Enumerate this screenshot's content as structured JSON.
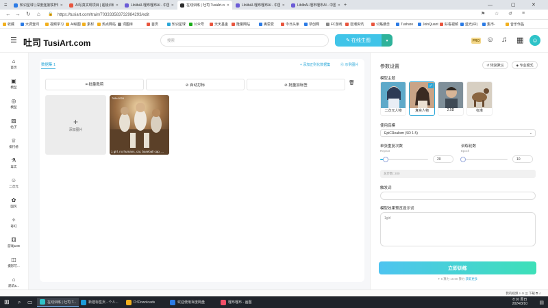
{
  "browser": {
    "tabs": [
      {
        "label": "知识星球 | 深度连接铁杆粉丝",
        "color": "#2c7be5",
        "active": false
      },
      {
        "label": "AI写真实现项目 | 超级训练营",
        "color": "#e8553e",
        "active": false
      },
      {
        "label": "LiblibAI-哩布哩布AI - 中国领",
        "color": "#6b5bd6",
        "active": false
      },
      {
        "label": "在线训练 | 吐司 TusiArt.com",
        "color": "#2b2b2b",
        "active": true
      },
      {
        "label": "LiblibAI-哩布哩布AI - 中国领",
        "color": "#6b5bd6",
        "active": false
      },
      {
        "label": "LiblibAI-哩布哩布AI - 中国领",
        "color": "#6b5bd6",
        "active": false
      }
    ],
    "new_tab": "+",
    "url": "https://tusiart.com/train/703333583732984293/edit",
    "bookmarks": [
      {
        "label": "收藏",
        "color": "#f2b01e"
      },
      {
        "label": "大调查问",
        "color": "#2c7be5"
      },
      {
        "label": "视频学习",
        "color": "#f2b01e"
      },
      {
        "label": "AI绘图",
        "color": "#f2b01e"
      },
      {
        "label": "素材",
        "color": "#f2b01e"
      },
      {
        "label": "热点网站",
        "color": "#f2b01e"
      },
      {
        "label": "词图库",
        "color": "#888888"
      },
      {
        "label": "首页",
        "color": "#e8553e"
      },
      {
        "label": "知识星球",
        "color": "#2aa7d8"
      },
      {
        "label": "公众号",
        "color": "#1aad19"
      },
      {
        "label": "天天基金",
        "color": "#e8553e"
      },
      {
        "label": "隆量网站",
        "color": "#e8553e"
      },
      {
        "label": "奥思爱",
        "color": "#2c7be5"
      },
      {
        "label": "今日头条",
        "color": "#e8553e"
      },
      {
        "label": "草创网",
        "color": "#2c7be5"
      },
      {
        "label": "FC游戏",
        "color": "#888888"
      },
      {
        "label": "巨潮资讯",
        "color": "#e8553e"
      },
      {
        "label": "公路悬念",
        "color": "#e8553e"
      },
      {
        "label": "Tushare",
        "color": "#2c7be5"
      },
      {
        "label": "JoinQuant",
        "color": "#2c7be5"
      },
      {
        "label": "好看视频",
        "color": "#e8553e"
      },
      {
        "label": "蓝光(中)",
        "color": "#2c7be5"
      },
      {
        "label": "集市-",
        "color": "#2c7be5"
      },
      {
        "label": "音乐作品",
        "color": "#f2b01e"
      }
    ]
  },
  "header": {
    "logo_mark": "吐司",
    "logo_text": "TusiArt.com",
    "search_placeholder": "搜索",
    "generate_label": "✎ 在线生图",
    "pro_badge": "PRO"
  },
  "sidebar": {
    "items": [
      {
        "label": "首页",
        "icon": "⌂",
        "icon_name": "home-icon"
      },
      {
        "label": "模型",
        "icon": "▣",
        "icon_name": "model-icon"
      },
      {
        "label": "模型",
        "icon": "◎",
        "icon_name": "compass-icon"
      },
      {
        "label": "帖子",
        "icon": "▨",
        "icon_name": "image-icon"
      },
      {
        "label": "排行榜",
        "icon": "♕",
        "icon_name": "trophy-icon"
      },
      {
        "label": "毒实",
        "icon": "⚗",
        "icon_name": "flask-icon"
      },
      {
        "label": "二次元",
        "icon": "☺",
        "icon_name": "anime-icon"
      },
      {
        "label": "国风",
        "icon": "✿",
        "icon_name": "flower-icon"
      },
      {
        "label": "奇幻",
        "icon": "✧",
        "icon_name": "fantasy-icon"
      },
      {
        "label": "游戏&3D",
        "icon": "⚅",
        "icon_name": "game-icon"
      },
      {
        "label": "摄影写...",
        "icon": "◫",
        "icon_name": "camera-icon"
      },
      {
        "label": "建筑&...",
        "icon": "⌂",
        "icon_name": "building-icon"
      }
    ]
  },
  "main": {
    "dataset_tab": "数据集 1",
    "add_dataset_link": "+ 添加正则化数据集",
    "example_link": "⓪ 示例图片",
    "toolbar": {
      "crop_label": "⌗ 批量裁剪",
      "tag_label": "⊘ 自动打标",
      "add_tag_label": "⊘ 批量加标签"
    },
    "add_image_plus": "+",
    "add_image_label": "添加图片",
    "thumb_tag": "768×1024",
    "thumb_caption": "1 girl, no humans, cat, baseball cap, ..."
  },
  "settings": {
    "title": "参数设置",
    "restore_label": "↺ 恢复默认",
    "pro_mode_label": "◈ 专业模式",
    "base_model_label": "模型主题",
    "models": [
      {
        "name": "二次元人物"
      },
      {
        "name": "真实人物",
        "selected": true
      },
      {
        "name": "2.5D"
      },
      {
        "name": "标准"
      }
    ],
    "base_label": "使用底模",
    "base_value": "EpiCRealism (SD 1.5)",
    "repeat_label": "单张重复次数",
    "repeat_sub": "Repeat",
    "repeat_value": "20",
    "repeat_fraction": 0.12,
    "epoch_label": "训练轮数",
    "epoch_sub": "Epoch",
    "epoch_value": "10",
    "epoch_fraction": 0.05,
    "seed_text": "总步数: 200",
    "trigger_label": "触发词",
    "prompt_label": "模型效果预览提示词",
    "prompt_value": "1girl",
    "train_label": "立即训练",
    "credit_text": "✦ 6 算力 10.00 算力",
    "credit_link": "获取更多"
  },
  "status": {
    "left": "",
    "right": "我的视频    ⌕    ⊙    ◫  下载    ⧉    ♫"
  },
  "taskbar": {
    "items": [
      {
        "label": "在线训练 | 吐司 T...",
        "color": "#2ec3c8",
        "active": true
      },
      {
        "label": "新建标签页 - 个人...",
        "color": "#1c9bd8",
        "active": false
      },
      {
        "label": "D:\\Downloads",
        "color": "#f2b01e",
        "active": false
      },
      {
        "label": "欢迎使用百度网盘",
        "color": "#2c7be5",
        "active": false
      },
      {
        "label": "哩布哩布 - 画图",
        "color": "#f24f68",
        "active": false
      }
    ],
    "time": "8:16 周日",
    "date": "2024/3/10"
  }
}
